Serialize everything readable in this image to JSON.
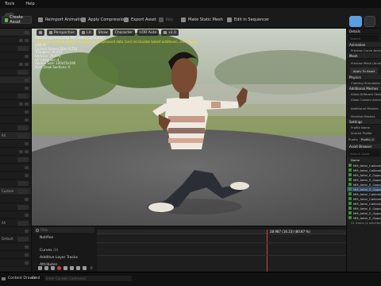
{
  "menubar": {
    "items": [
      "Tools",
      "Help"
    ]
  },
  "toolbar": {
    "create_asset": "Create Asset",
    "reimport": "Reimport Animation",
    "apply_compression": "Apply Compression",
    "export_asset": "Export Asset",
    "key": "Key",
    "make_static_mesh": "Make Static Mesh",
    "edit_in_sequencer": "Edit in Sequencer"
  },
  "viewport": {
    "toolbar": [
      "Perspective",
      "Lit",
      "Show",
      "Character",
      "LOD Auto",
      "x1.0"
    ],
    "info_lines": [
      "Previewing Animation MM_Aetni_Calibration",
      "Animation is being edited. To apply to compressed data (and recalculate baked additives), click \"Apply\"",
      "LOD: 0",
      "Current Screen Size: 0.714",
      "Triangles: 78,503",
      "Vertices: 79,970",
      "UV Channels: 4",
      "Approx Size: 100x55x196",
      "Num Draw Sections: 6"
    ]
  },
  "left_panel": {
    "labels": [
      "All",
      "Custom",
      "All",
      "Default"
    ]
  },
  "timeline": {
    "filter_placeholder": "Filter",
    "tracks": [
      "Notifies",
      "Curves",
      "Additive Layer Tracks",
      "Attributes"
    ],
    "track_counts": {
      "curves": "(0)"
    },
    "timecode": "28.987 (16.23) (80.87 %)",
    "counter": "0"
  },
  "status_bar": {
    "drawer": "Content Drawer",
    "cmd": "Cmd",
    "console_placeholder": "Enter Console Command"
  },
  "details": {
    "title": "Details",
    "search_placeholder": "Search",
    "sections": [
      {
        "header": "Animation",
        "rows": [
          "Preview Curve Animation"
        ]
      },
      {
        "header": "Mesh",
        "rows": [
          "Preview Mesh (Animation)"
        ]
      },
      {
        "button": "Apply To Asset"
      },
      {
        "header": "Physics",
        "rows": [
          "Clothing Simulation"
        ]
      },
      {
        "header": "Additional Meshes",
        "rows": [
          "Allow Different Skeleton",
          "Allow Custom Animation",
          "Additional Meshes"
        ]
      },
      {
        "header": "",
        "rows": [
          "Skeletal Meshes"
        ]
      },
      {
        "header": "Settings",
        "rows": [
          "Profile Name",
          "Shared Profile"
        ]
      }
    ],
    "profile_label": "Profile",
    "profile_value": "Profile_0"
  },
  "asset_browser": {
    "title": "Asset Browser",
    "search_placeholder": "Search Asset",
    "column_name": "Name",
    "items": [
      "MM_Aetni_Calibration",
      "MM_Aetni_Calibration",
      "MM_Aetni_E_Opposite",
      "MM_Aetni_E_Opposite",
      "MM_Aetni_E_Opposite",
      "MM_Aetni_E_Opposite",
      "MM_Aetni_Calibration",
      "MM_Aetni_Calibration",
      "MM_Aetni_Calibration",
      "MM_Aetni_E_Opposite",
      "MM_Aetni_E_Opposite",
      "MM_Aetni_E_Opposite"
    ],
    "selected_index": 5,
    "footer": "31 items (1 selected)"
  },
  "colors": {
    "accent": "#4a8fd1",
    "warning": "#ffde00",
    "selection": "#2f4a66"
  }
}
